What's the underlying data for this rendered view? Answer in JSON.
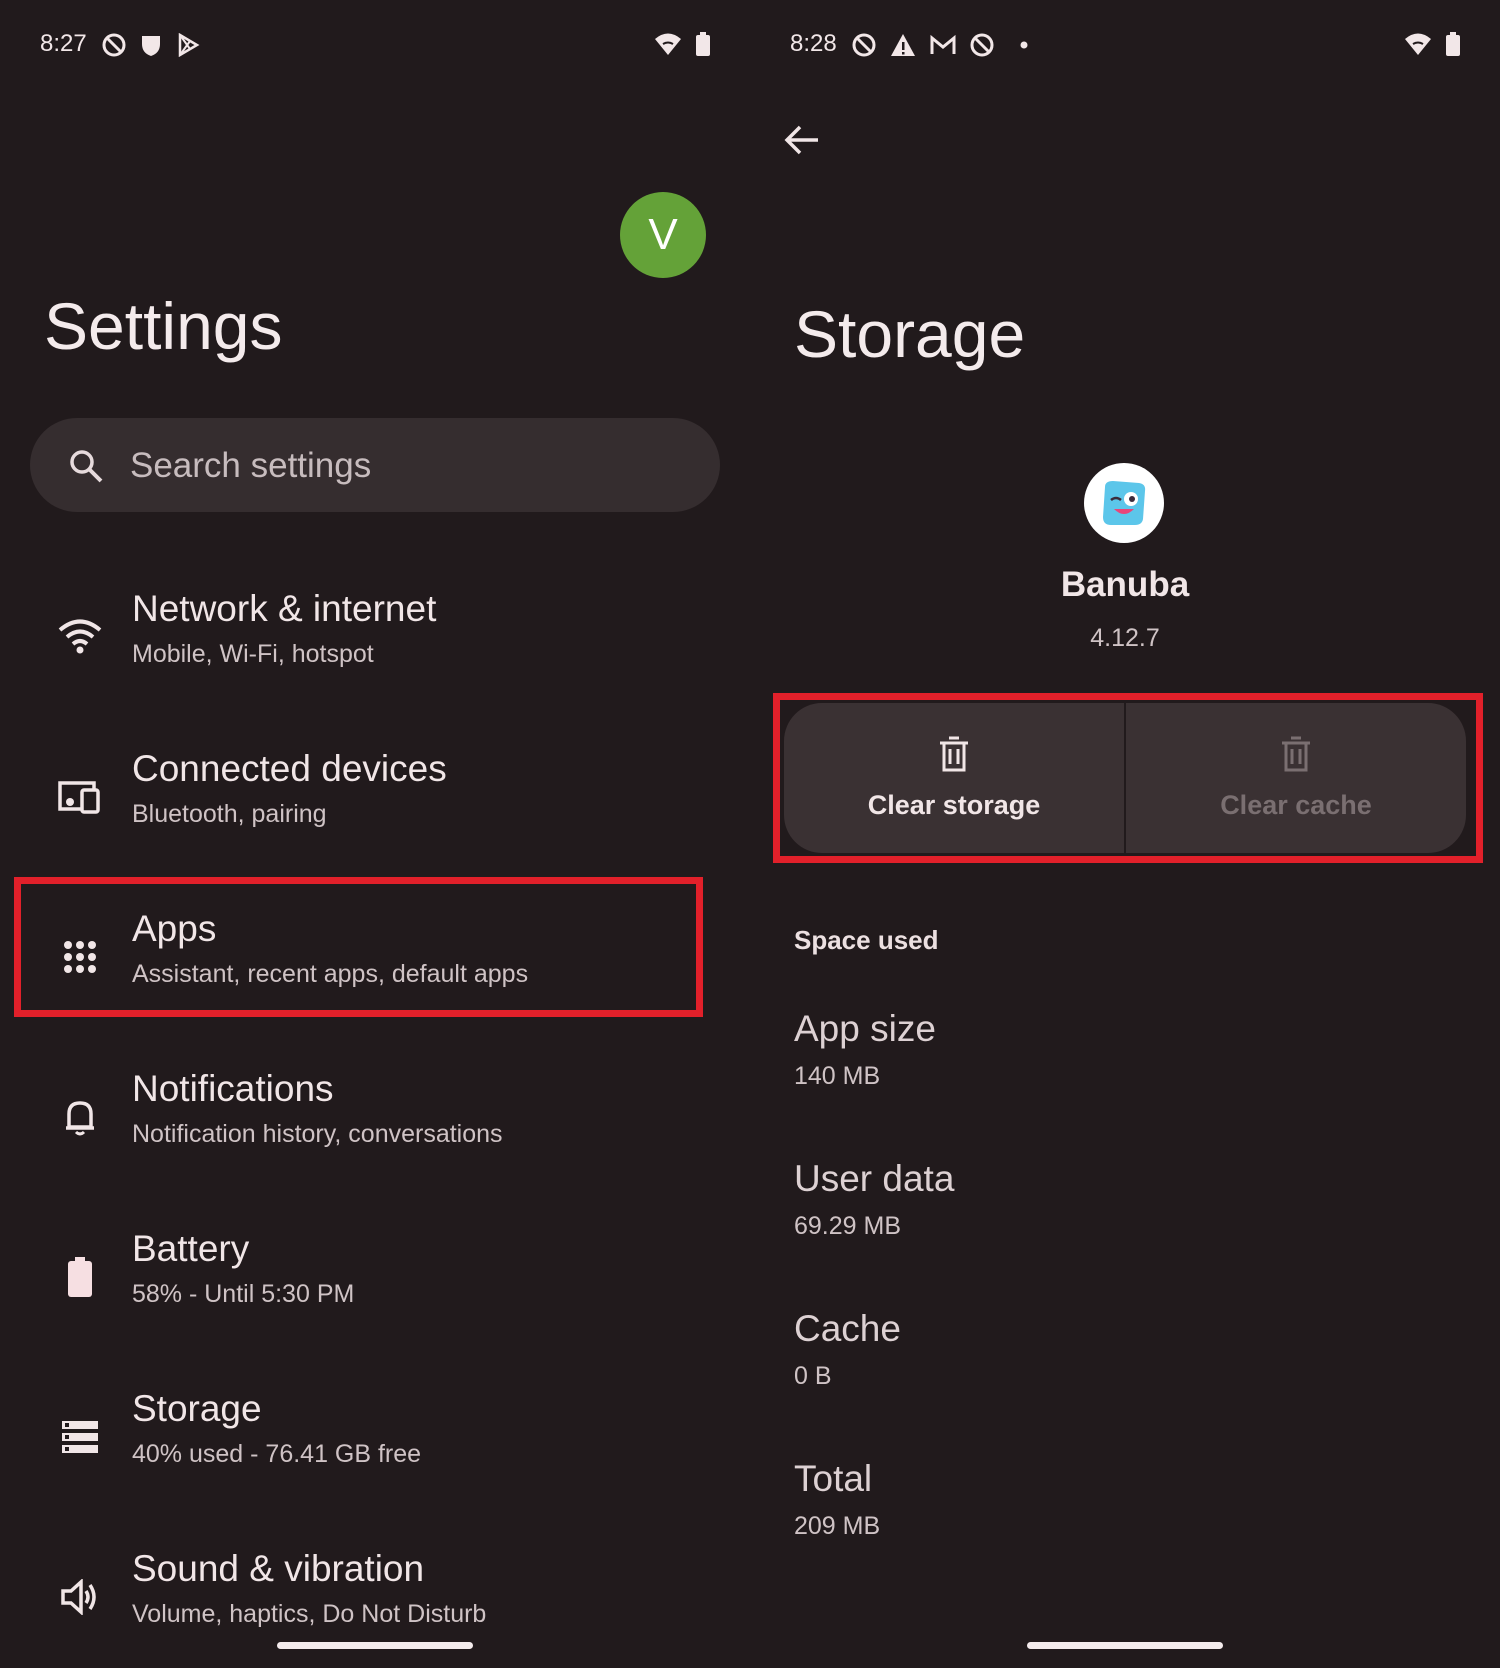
{
  "left": {
    "status": {
      "time": "8:27"
    },
    "avatar": {
      "letter": "V",
      "color": "#64a238"
    },
    "title": "Settings",
    "search": {
      "placeholder": "Search settings"
    },
    "items": [
      {
        "title": "Network & internet",
        "subtitle": "Mobile, Wi-Fi, hotspot",
        "icon": "wifi-icon"
      },
      {
        "title": "Connected devices",
        "subtitle": "Bluetooth, pairing",
        "icon": "devices-icon"
      },
      {
        "title": "Apps",
        "subtitle": "Assistant, recent apps, default apps",
        "icon": "apps-grid-icon"
      },
      {
        "title": "Notifications",
        "subtitle": "Notification history, conversations",
        "icon": "bell-icon"
      },
      {
        "title": "Battery",
        "subtitle": "58% - Until 5:30 PM",
        "icon": "battery-icon"
      },
      {
        "title": "Storage",
        "subtitle": "40% used - 76.41 GB free",
        "icon": "storage-icon"
      },
      {
        "title": "Sound & vibration",
        "subtitle": "Volume, haptics, Do Not Disturb",
        "icon": "speaker-icon"
      }
    ]
  },
  "right": {
    "status": {
      "time": "8:28"
    },
    "title": "Storage",
    "app": {
      "name": "Banuba",
      "version": "4.12.7"
    },
    "buttons": {
      "clear_storage": "Clear storage",
      "clear_cache": "Clear cache"
    },
    "section": "Space used",
    "stats": [
      {
        "title": "App size",
        "value": "140 MB"
      },
      {
        "title": "User data",
        "value": "69.29 MB"
      },
      {
        "title": "Cache",
        "value": "0 B"
      },
      {
        "title": "Total",
        "value": "209 MB"
      }
    ]
  },
  "colors": {
    "background": "#211a1c",
    "highlight": "#e2202a",
    "surface": "#352d2f"
  }
}
